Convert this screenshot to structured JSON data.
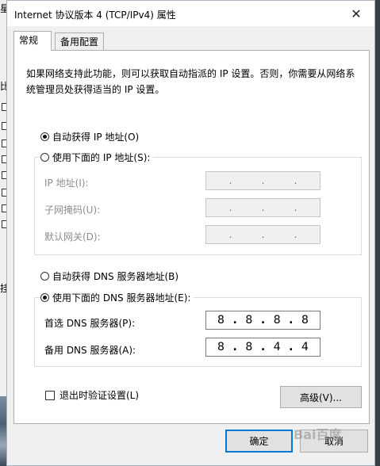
{
  "window": {
    "title": "Internet 协议版本 4 (TCP/IPv4) 属性",
    "close_glyph": "✕"
  },
  "background": {
    "fragments": [
      "星",
      "比",
      "挂"
    ]
  },
  "tabs": [
    {
      "label": "常规",
      "active": true
    },
    {
      "label": "备用配置",
      "active": false
    }
  ],
  "general": {
    "description": "如果网络支持此功能，则可以获取自动指派的 IP 设置。否则，你需要从网络系统管理员处获得适当的 IP 设置。",
    "ip_auto_label": "自动获得 IP 地址(O)",
    "ip_auto_selected": true,
    "ip_manual_label": "使用下面的 IP 地址(S):",
    "ip_manual_selected": false,
    "ip_fields": [
      {
        "label": "IP 地址(I):",
        "octets": [
          "",
          "",
          "",
          ""
        ],
        "dots": [
          ".",
          ".",
          "."
        ]
      },
      {
        "label": "子网掩码(U):",
        "octets": [
          "",
          "",
          "",
          ""
        ],
        "dots": [
          ".",
          ".",
          "."
        ]
      },
      {
        "label": "默认网关(D):",
        "octets": [
          "",
          "",
          "",
          ""
        ],
        "dots": [
          ".",
          ".",
          "."
        ]
      }
    ],
    "dns_auto_label": "自动获得 DNS 服务器地址(B)",
    "dns_auto_selected": false,
    "dns_manual_label": "使用下面的 DNS 服务器地址(E):",
    "dns_manual_selected": true,
    "dns_fields": [
      {
        "label": "首选 DNS 服务器(P):",
        "octets": [
          "8",
          "8",
          "8",
          "8"
        ]
      },
      {
        "label": "备用 DNS 服务器(A):",
        "octets": [
          "8",
          "8",
          "4",
          "4"
        ]
      }
    ],
    "validate_label": "退出时验证设置(L)",
    "validate_checked": false,
    "advanced_label": "高级(V)..."
  },
  "footer": {
    "ok_label": "确定",
    "cancel_label": "取消"
  },
  "watermark": "Bai百度"
}
